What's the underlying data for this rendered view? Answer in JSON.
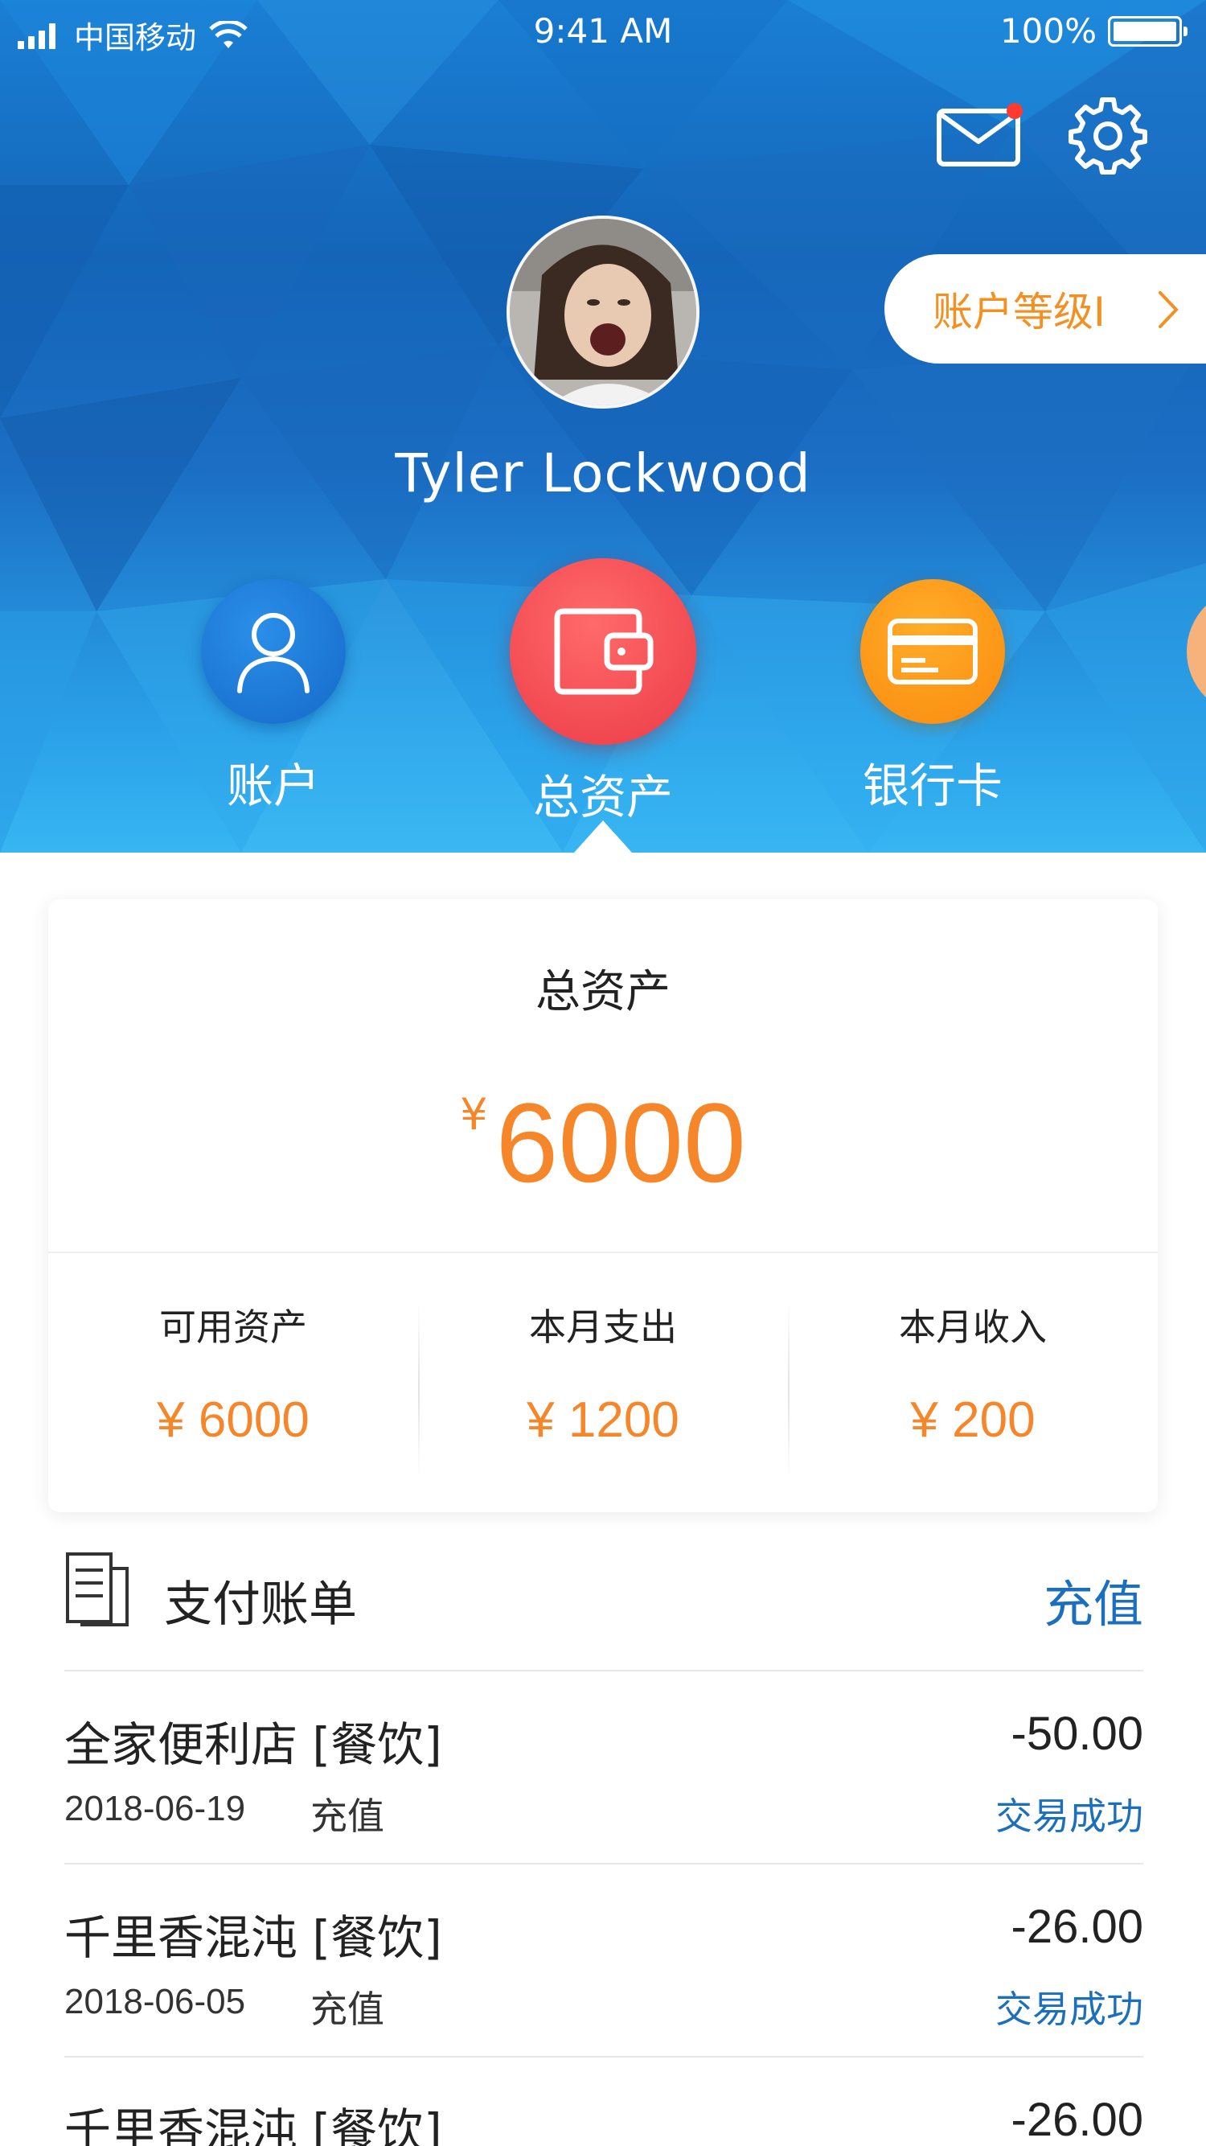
{
  "status_bar": {
    "carrier": "中国移动",
    "time": "9:41 AM",
    "battery": "100%"
  },
  "header": {
    "user_name": "Tyler Lockwood",
    "level_label": "账户等级I",
    "has_unread_mail": true
  },
  "nav": {
    "items": [
      {
        "label": "账户",
        "icon": "user-icon",
        "color": "#1a76d6"
      },
      {
        "label": "总资产",
        "icon": "wallet-icon",
        "color": "#ef4450",
        "active": true
      },
      {
        "label": "银行卡",
        "icon": "bank-card-icon",
        "color": "#fd8f10"
      }
    ]
  },
  "summary": {
    "title": "总资产",
    "currency": "¥",
    "total": "6000",
    "stats": [
      {
        "label": "可用资产",
        "value": "¥ 6000"
      },
      {
        "label": "本月支出",
        "value": "¥ 1200"
      },
      {
        "label": "本月收入",
        "value": "¥ 200"
      }
    ]
  },
  "bills": {
    "title": "支付账单",
    "action": "充值",
    "items": [
      {
        "merchant": "全家便利店 [餐饮]",
        "amount": "-50.00",
        "date": "2018-06-19",
        "type": "充值",
        "status": "交易成功"
      },
      {
        "merchant": "千里香混沌 [餐饮]",
        "amount": "-26.00",
        "date": "2018-06-05",
        "type": "充值",
        "status": "交易成功"
      },
      {
        "merchant": "千里香混沌 [餐饮]",
        "amount": "-26.00",
        "date": "",
        "type": "",
        "status": ""
      }
    ]
  },
  "colors": {
    "accent_orange": "#f5862a",
    "link_blue": "#1c6fbd",
    "header_blue": "#1a76d6"
  }
}
